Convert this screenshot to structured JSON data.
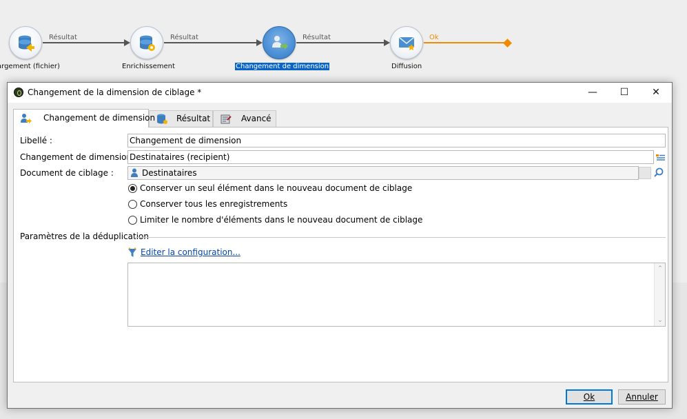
{
  "workflow": {
    "nodes": [
      {
        "label": "argement (fichier)",
        "icon": "database-load-icon"
      },
      {
        "label": "Enrichissement",
        "icon": "database-enrich-icon"
      },
      {
        "label": "Changement de dimension",
        "icon": "change-dimension-icon",
        "selected": true
      },
      {
        "label": "Diffusion",
        "icon": "delivery-email-icon"
      }
    ],
    "transitions": [
      "Résultat",
      "Résultat",
      "Résultat",
      "Ok"
    ],
    "colors": {
      "transition": "#555555",
      "ok": "#f08a00",
      "selected_label": "#0a64c8"
    }
  },
  "dialog": {
    "title": "Changement de la dimension de ciblage *",
    "window_controls": {
      "minimize": "—",
      "maximize": "☐",
      "close": "✕"
    },
    "tabs": [
      {
        "label": "Changement de dimension",
        "icon": "change-dimension-icon",
        "active": true
      },
      {
        "label": "Résultat",
        "icon": "database-icon"
      },
      {
        "label": "Avancé",
        "icon": "advanced-settings-icon"
      }
    ],
    "form": {
      "libelle_label": "Libellé :",
      "libelle_value": "Changement de dimension",
      "dimension_label": "Changement de dimension :",
      "dimension_value": "Destinataires (recipient)",
      "document_label": "Document de ciblage :",
      "document_value": "Destinataires",
      "radios": [
        {
          "label": "Conserver un seul élément dans le nouveau document de ciblage",
          "checked": true
        },
        {
          "label": "Conserver tous les enregistrements",
          "checked": false
        },
        {
          "label": "Limiter le nombre d'éléments dans le nouveau document de ciblage",
          "checked": false
        }
      ],
      "dedup_section": "Paramètres de la déduplication",
      "dedup_link": "Editer la configuration...",
      "dedup_text": ""
    },
    "buttons": {
      "ok": "Ok",
      "cancel": "Annuler"
    }
  }
}
